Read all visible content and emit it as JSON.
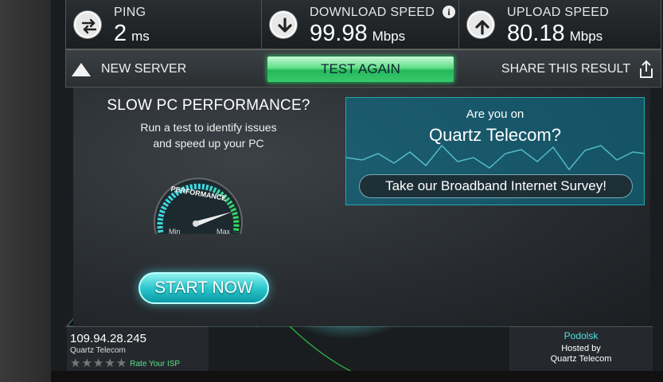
{
  "stats": {
    "ping": {
      "label": "PING",
      "value": "2",
      "unit": "ms",
      "icon": "ping-arrows-icon"
    },
    "download": {
      "label": "DOWNLOAD SPEED",
      "value": "99.98",
      "unit": "Mbps",
      "icon": "download-arrow-icon"
    },
    "upload": {
      "label": "UPLOAD SPEED",
      "value": "80.18",
      "unit": "Mbps",
      "icon": "upload-arrow-icon"
    },
    "info_glyph": "i"
  },
  "actions": {
    "new_server": "NEW SERVER",
    "test_again": "TEST AGAIN",
    "share": "SHARE THIS RESULT"
  },
  "promo": {
    "title": "SLOW PC PERFORMANCE?",
    "line1": "Run a test to identify issues",
    "line2": "and speed up your PC",
    "gauge_label": "PERFORMANCE",
    "gauge_min": "Min",
    "gauge_max": "Max",
    "start_button": "START NOW"
  },
  "survey": {
    "line1": "Are you on",
    "line2": "Quartz Telecom?",
    "button": "Take our Broadband Internet Survey!"
  },
  "isp": {
    "ip": "109.94.28.245",
    "name": "Quartz Telecom",
    "rating_stars": 5,
    "rating_value": 0,
    "rate_label": "Rate Your ISP"
  },
  "server": {
    "city": "Podolsk",
    "hosted_by": "Hosted by",
    "host": "Quartz Telecom"
  },
  "colors": {
    "accent_green": "#39c96c",
    "accent_cyan": "#2bc7cc",
    "map_lines": "#2fd84f"
  }
}
